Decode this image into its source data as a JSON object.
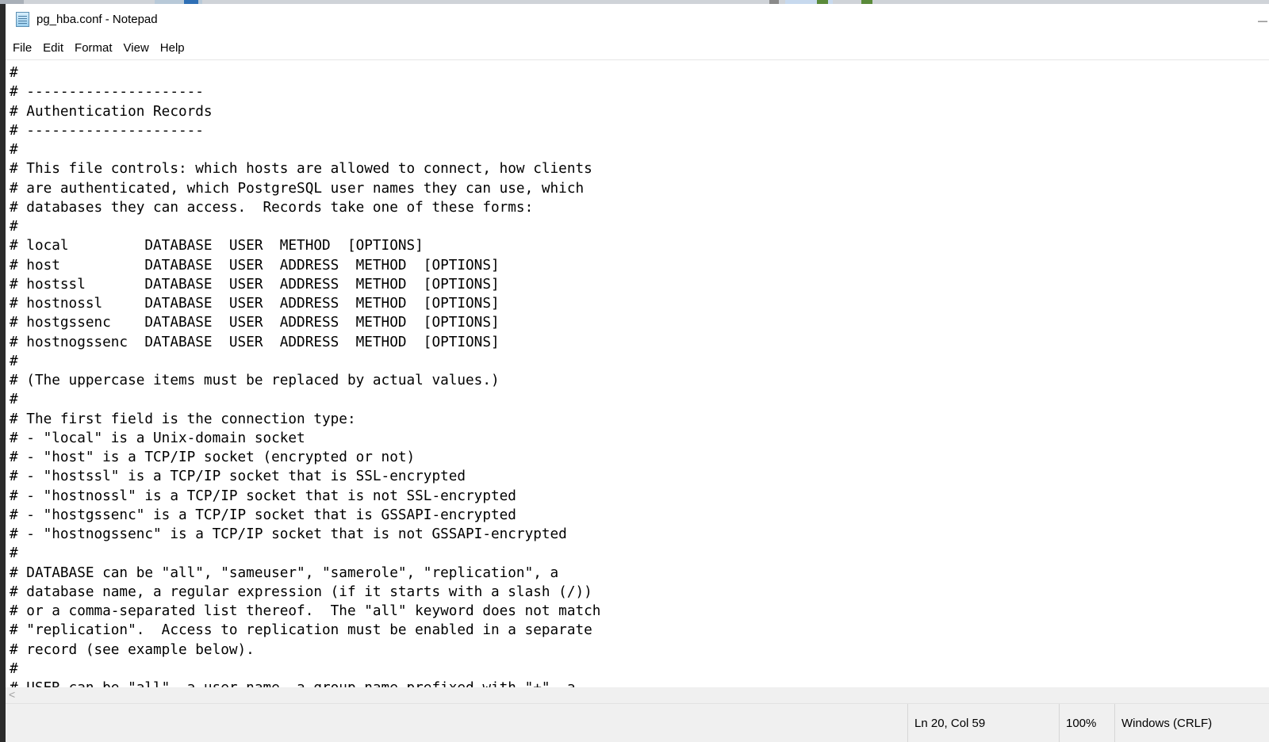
{
  "window": {
    "title": "pg_hba.conf - Notepad",
    "title_cut": "—"
  },
  "menu": {
    "file": "File",
    "edit": "Edit",
    "format": "Format",
    "view": "View",
    "help": "Help"
  },
  "document": {
    "lines": [
      "#",
      "# ---------------------",
      "# Authentication Records",
      "# ---------------------",
      "#",
      "# This file controls: which hosts are allowed to connect, how clients",
      "# are authenticated, which PostgreSQL user names they can use, which",
      "# databases they can access.  Records take one of these forms:",
      "#",
      "# local         DATABASE  USER  METHOD  [OPTIONS]",
      "# host          DATABASE  USER  ADDRESS  METHOD  [OPTIONS]",
      "# hostssl       DATABASE  USER  ADDRESS  METHOD  [OPTIONS]",
      "# hostnossl     DATABASE  USER  ADDRESS  METHOD  [OPTIONS]",
      "# hostgssenc    DATABASE  USER  ADDRESS  METHOD  [OPTIONS]",
      "# hostnogssenc  DATABASE  USER  ADDRESS  METHOD  [OPTIONS]",
      "#",
      "# (The uppercase items must be replaced by actual values.)",
      "#",
      "# The first field is the connection type:",
      "# - \"local\" is a Unix-domain socket",
      "# - \"host\" is a TCP/IP socket (encrypted or not)",
      "# - \"hostssl\" is a TCP/IP socket that is SSL-encrypted",
      "# - \"hostnossl\" is a TCP/IP socket that is not SSL-encrypted",
      "# - \"hostgssenc\" is a TCP/IP socket that is GSSAPI-encrypted",
      "# - \"hostnogssenc\" is a TCP/IP socket that is not GSSAPI-encrypted",
      "#",
      "# DATABASE can be \"all\", \"sameuser\", \"samerole\", \"replication\", a",
      "# database name, a regular expression (if it starts with a slash (/))",
      "# or a comma-separated list thereof.  The \"all\" keyword does not match",
      "# \"replication\".  Access to replication must be enabled in a separate",
      "# record (see example below).",
      "#",
      "# USER can be \"all\", a user name, a group name prefixed with \"+\", a"
    ]
  },
  "scrollbar": {
    "left_arrow": "<"
  },
  "status": {
    "position": "Ln 20, Col 59",
    "zoom": "100%",
    "line_ending": "Windows (CRLF)"
  },
  "colors": {
    "desktop_strip": "#cfd3d8",
    "left_edge": "#2b2b2b",
    "statusbar_bg": "#f0f0f0"
  }
}
